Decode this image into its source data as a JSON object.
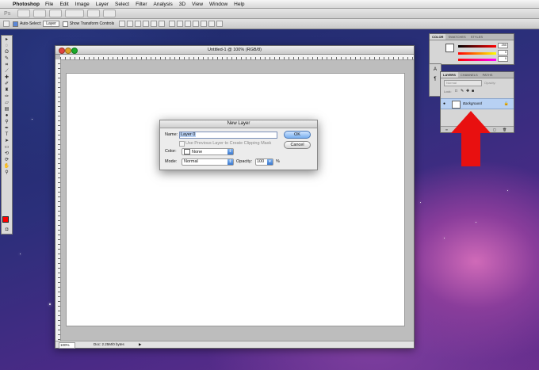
{
  "menubar": {
    "app_name": "Photoshop",
    "items": [
      "File",
      "Edit",
      "Image",
      "Layer",
      "Select",
      "Filter",
      "Analysis",
      "3D",
      "View",
      "Window",
      "Help"
    ]
  },
  "appbar": {
    "logo": "Ps"
  },
  "options_bar": {
    "auto_select_label": "Auto-Select:",
    "auto_select_value": "Layer",
    "transform_controls_label": "Show Transform Controls"
  },
  "document": {
    "title": "Untitled-1 @ 100% (RGB/8)",
    "zoom": "100%",
    "doc_info": "Doc: 2.25M/0 bytes"
  },
  "dialog": {
    "title": "New Layer",
    "name_label": "Name:",
    "name_value": "Layer 0",
    "clip_label": "Use Previous Layer to Create Clipping Mask",
    "color_label": "Color:",
    "color_value": "None",
    "mode_label": "Mode:",
    "mode_value": "Normal",
    "opacity_label": "Opacity:",
    "opacity_value": "100",
    "opacity_unit": "%",
    "ok_label": "OK",
    "cancel_label": "Cancel"
  },
  "color_panel": {
    "tabs": [
      "COLOR",
      "SWATCHES",
      "STYLES"
    ],
    "values": [
      "255",
      "0",
      "0"
    ]
  },
  "layers_panel": {
    "tabs": [
      "LAYERS",
      "CHANNELS",
      "PATHS"
    ],
    "blend_mode": "Normal",
    "opacity_label": "Opacity:",
    "lock_label": "Lock:",
    "layer_name": "Background"
  },
  "colors": {
    "foreground": "#ff0000",
    "highlight_arrow": "#e81010"
  }
}
